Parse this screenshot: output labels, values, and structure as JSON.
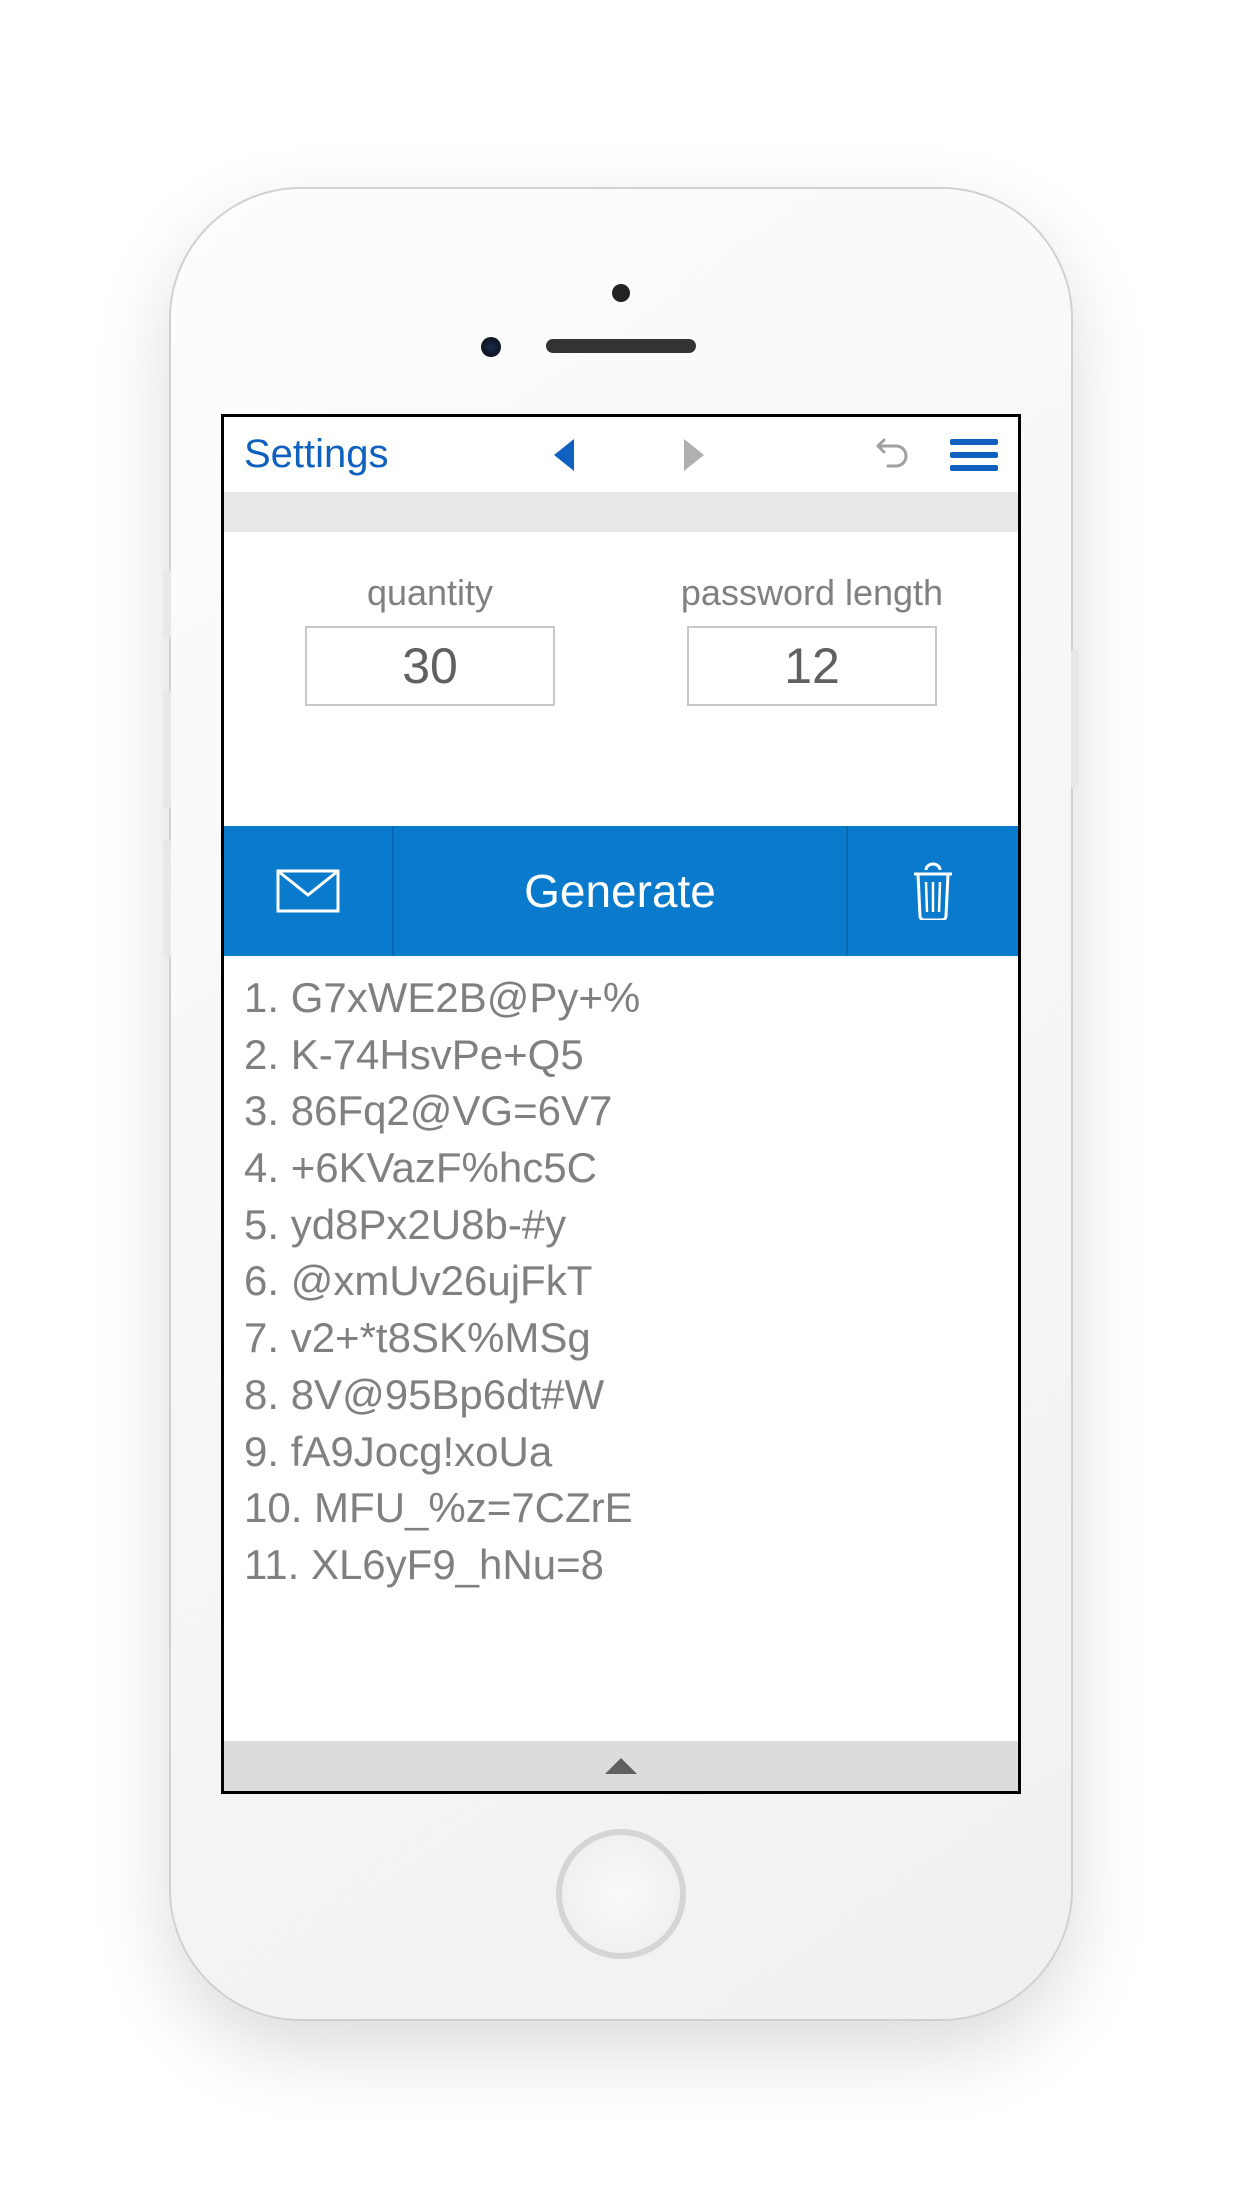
{
  "toolbar": {
    "settings_label": "Settings"
  },
  "inputs": {
    "quantity": {
      "label": "quantity",
      "value": "30"
    },
    "length": {
      "label": "password length",
      "value": "12"
    }
  },
  "actions": {
    "generate_label": "Generate"
  },
  "results": [
    "1. G7xWE2B@Py+%",
    "2. K-74HsvPe+Q5",
    "3. 86Fq2@VG=6V7",
    "4. +6KVazF%hc5C",
    "5. yd8Px2U8b-#y",
    "6. @xmUv26ujFkT",
    "7. v2+*t8SK%MSg",
    "8. 8V@95Bp6dt#W",
    "9. fA9Jocg!xoUa",
    "10. MFU_%z=7CZrE",
    "11. XL6yF9_hNu=8"
  ],
  "colors": {
    "accent": "#1060c0",
    "action_bg": "#0a7acc"
  }
}
